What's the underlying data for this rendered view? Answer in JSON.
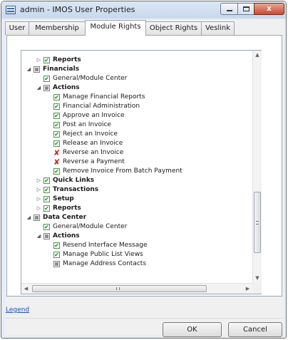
{
  "window": {
    "title": "admin - IMOS User Properties",
    "close_glyph": "x"
  },
  "tabs": [
    {
      "label": "User"
    },
    {
      "label": "Membership"
    },
    {
      "label": "Module Rights"
    },
    {
      "label": "Object Rights"
    },
    {
      "label": "Veslink"
    }
  ],
  "active_tab": "Module Rights",
  "tree": {
    "rows": [
      {
        "label": "Reports",
        "bold": true,
        "state": "checked",
        "expander": "collapsed",
        "level": 1
      },
      {
        "label": "Financials",
        "bold": true,
        "state": "indeterminate",
        "expander": "expanded",
        "level": 0
      },
      {
        "label": "General/Module Center",
        "bold": false,
        "state": "checked",
        "expander": "none",
        "level": 1
      },
      {
        "label": "Actions",
        "bold": true,
        "state": "indeterminate",
        "expander": "expanded",
        "level": 1
      },
      {
        "label": "Manage Financial Reports",
        "bold": false,
        "state": "checked",
        "expander": "none",
        "level": 2
      },
      {
        "label": "Financial Administration",
        "bold": false,
        "state": "checked",
        "expander": "none",
        "level": 2
      },
      {
        "label": "Approve an Invoice",
        "bold": false,
        "state": "checked",
        "expander": "none",
        "level": 2
      },
      {
        "label": "Post an Invoice",
        "bold": false,
        "state": "checked",
        "expander": "none",
        "level": 2
      },
      {
        "label": "Reject an Invoice",
        "bold": false,
        "state": "checked",
        "expander": "none",
        "level": 2
      },
      {
        "label": "Release an Invoice",
        "bold": false,
        "state": "checked",
        "expander": "none",
        "level": 2
      },
      {
        "label": "Reverse an Invoice",
        "bold": false,
        "state": "denied",
        "expander": "none",
        "level": 2
      },
      {
        "label": "Reverse a Payment",
        "bold": false,
        "state": "denied",
        "expander": "none",
        "level": 2
      },
      {
        "label": "Remove Invoice From Batch Payment",
        "bold": false,
        "state": "checked",
        "expander": "none",
        "level": 2
      },
      {
        "label": "Quick Links",
        "bold": true,
        "state": "checked",
        "expander": "collapsed",
        "level": 1
      },
      {
        "label": "Transactions",
        "bold": true,
        "state": "checked",
        "expander": "collapsed",
        "level": 1
      },
      {
        "label": "Setup",
        "bold": true,
        "state": "checked",
        "expander": "collapsed",
        "level": 1
      },
      {
        "label": "Reports",
        "bold": true,
        "state": "checked",
        "expander": "collapsed",
        "level": 1
      },
      {
        "label": "Data Center",
        "bold": true,
        "state": "indeterminate",
        "expander": "expanded",
        "level": 0
      },
      {
        "label": "General/Module Center",
        "bold": false,
        "state": "checked",
        "expander": "none",
        "level": 1
      },
      {
        "label": "Actions",
        "bold": true,
        "state": "indeterminate",
        "expander": "expanded",
        "level": 1
      },
      {
        "label": "Resend Interface Message",
        "bold": false,
        "state": "checked",
        "expander": "none",
        "level": 2
      },
      {
        "label": "Manage Public List Views",
        "bold": false,
        "state": "checked",
        "expander": "none",
        "level": 2
      },
      {
        "label": "Manage Address Contacts",
        "bold": false,
        "state": "indeterminate",
        "expander": "none",
        "level": 2
      }
    ],
    "glyphs": {
      "checked": "✔",
      "denied": "✘",
      "expanded": "◢",
      "collapsed": "▷",
      "scroll_up": "▲",
      "scroll_down": "▼",
      "scroll_left": "◀",
      "scroll_right": "▶"
    }
  },
  "legend_link": "Legend",
  "buttons": {
    "ok": "OK",
    "cancel": "Cancel"
  }
}
